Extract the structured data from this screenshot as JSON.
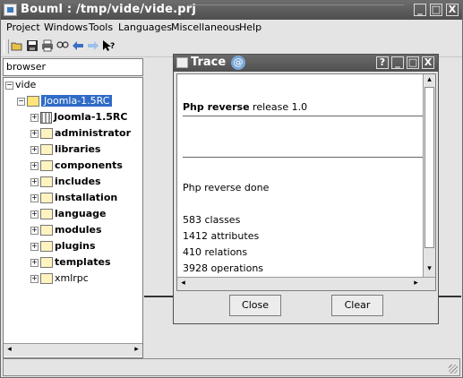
{
  "window": {
    "title": "Bouml : /tmp/vide/vide.prj",
    "controls": [
      "_",
      "□",
      "X"
    ]
  },
  "menubar": {
    "items": [
      "Project",
      "Windows",
      "Tools",
      "Languages",
      "Miscellaneous",
      "Help"
    ]
  },
  "toolbar": {
    "icons": [
      "open-icon",
      "save-icon",
      "print-icon",
      "search-icon",
      "back-arrow-icon",
      "forward-arrow-icon",
      "whats-this-icon"
    ]
  },
  "browser": {
    "header": "browser",
    "root": "vide",
    "project": "Joomla-1.5RC",
    "items": [
      "Joomla-1.5RC",
      "administrator",
      "libraries",
      "components",
      "includes",
      "installation",
      "language",
      "modules",
      "plugins",
      "templates",
      "xmlrpc"
    ]
  },
  "trace": {
    "title": "Trace",
    "controls": [
      "?",
      "_",
      "□",
      "X"
    ],
    "header_bold": "Php reverse",
    "header_rest": " release 1.0",
    "done": "Php reverse done",
    "stats": [
      "583 classes",
      "1412 attributes",
      "410 relations",
      "3928 operations"
    ],
    "close_label": "Close",
    "clear_label": "Clear"
  },
  "colors": {
    "title_bar": "#5a5a5a",
    "selection": "#2f6bc7",
    "background": "#e4e4e4"
  }
}
